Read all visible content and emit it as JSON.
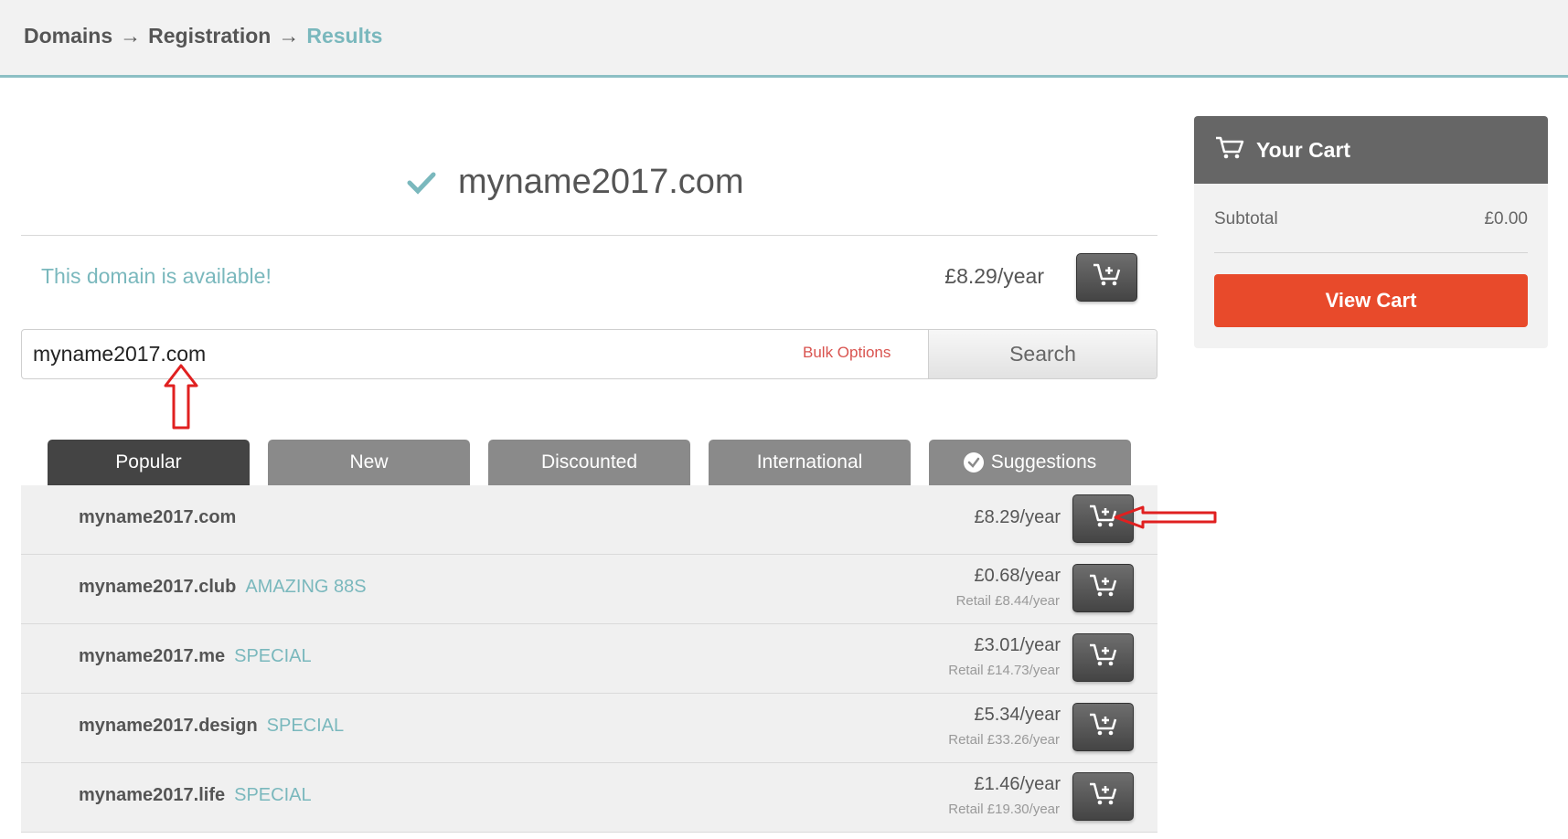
{
  "breadcrumb": {
    "items": [
      "Domains",
      "Registration",
      "Results"
    ],
    "separator": "→"
  },
  "result": {
    "domain": "myname2017.com",
    "availability_text": "This domain is available!",
    "price": "£8.29/year"
  },
  "search": {
    "value": "myname2017.com",
    "bulk_options_label": "Bulk Options",
    "button_label": "Search"
  },
  "tabs": [
    {
      "label": "Popular",
      "active": true
    },
    {
      "label": "New"
    },
    {
      "label": "Discounted"
    },
    {
      "label": "International"
    },
    {
      "label": "Suggestions",
      "icon": "check-circle-icon"
    }
  ],
  "results": [
    {
      "name": "myname2017.com",
      "tag": "",
      "price": "£8.29/year",
      "retail": ""
    },
    {
      "name": "myname2017.club",
      "tag": "AMAZING 88S",
      "price": "£0.68/year",
      "retail": "Retail £8.44/year"
    },
    {
      "name": "myname2017.me",
      "tag": "SPECIAL",
      "price": "£3.01/year",
      "retail": "Retail £14.73/year"
    },
    {
      "name": "myname2017.design",
      "tag": "SPECIAL",
      "price": "£5.34/year",
      "retail": "Retail £33.26/year"
    },
    {
      "name": "myname2017.life",
      "tag": "SPECIAL",
      "price": "£1.46/year",
      "retail": "Retail £19.30/year"
    }
  ],
  "cart": {
    "title": "Your Cart",
    "subtotal_label": "Subtotal",
    "subtotal_value": "£0.00",
    "view_cart_label": "View Cart"
  },
  "colors": {
    "accent_teal": "#7ab8bd",
    "view_cart_red": "#e84a2b",
    "annotation_red": "#e02020",
    "tab_active": "#444444",
    "tab_inactive": "#8a8a8a"
  }
}
